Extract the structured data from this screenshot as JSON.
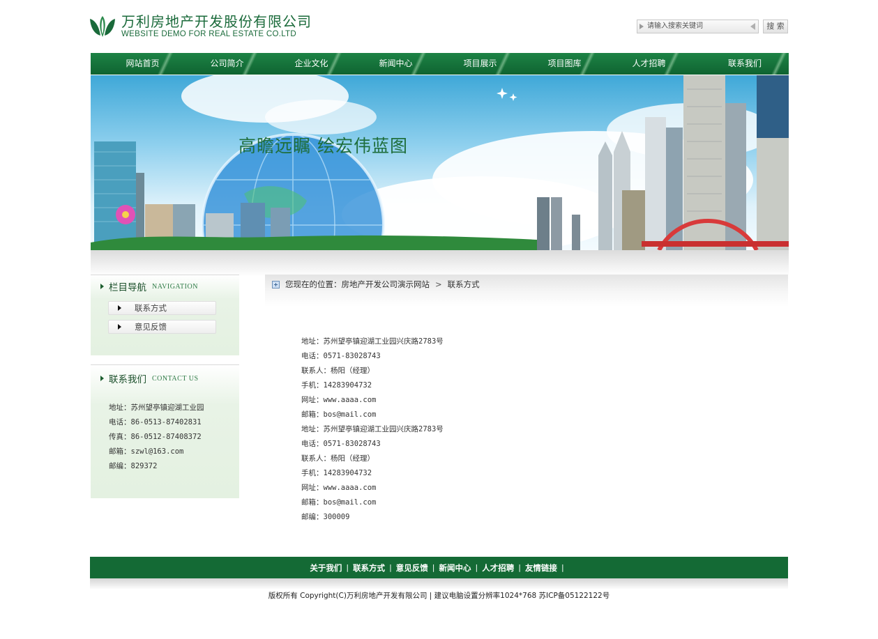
{
  "logo": {
    "cn": "万利房地产开发股份有限公司",
    "en": "WEBSITE DEMO FOR REAL ESTATE CO.LTD"
  },
  "search": {
    "placeholder": "请输入搜索关键词",
    "button": "搜 索"
  },
  "nav": [
    "网站首页",
    "公司简介",
    "企业文化",
    "新闻中心",
    "项目展示",
    "项目图库",
    "人才招聘",
    "联系我们"
  ],
  "banner": {
    "slogan": "高瞻远瞩  绘宏伟蓝图"
  },
  "sidebar": {
    "nav_title": "栏目导航",
    "nav_sub": "NAVIGATION",
    "links": [
      "联系方式",
      "意见反馈"
    ],
    "contact_title": "联系我们",
    "contact_sub": "CONTACT US",
    "contact_lines": [
      "地址：苏州望亭镇迎湖工业园",
      "电话：86-0513-87402831",
      "传真：86-0512-87408372",
      "邮箱：szwl@163.com",
      "邮编：829372"
    ]
  },
  "breadcrumb": {
    "prefix": "您现在的位置：",
    "home": "房地产开发公司演示网站",
    "sep": ">",
    "current": "联系方式"
  },
  "contact_main": [
    "地址：苏州望亭镇迎湖工业园兴庆路2783号",
    "电话：0571-83028743",
    "联系人：杨阳（经理）",
    "手机：14283904732",
    "网址：www.aaaa.com",
    "邮箱：bos@mail.com",
    "地址：苏州望亭镇迎湖工业园兴庆路2783号",
    "电话：0571-83028743",
    "联系人：杨阳（经理）",
    "手机：14283904732",
    "网址：www.aaaa.com",
    "邮箱：bos@mail.com",
    "邮编：300009"
  ],
  "footer": {
    "links": [
      "关于我们",
      "联系方式",
      "意见反馈",
      "新闻中心",
      "人才招聘",
      "友情链接"
    ],
    "sep": "|",
    "copyright": "版权所有  Copyright(C)万利房地产开发有限公司 | 建议电脑设置分辨率1024*768  苏ICP备05122122号"
  },
  "colors": {
    "brand_green": "#137039",
    "footer_green": "#146a35",
    "sidebar_bg": "#e4f1e1"
  }
}
